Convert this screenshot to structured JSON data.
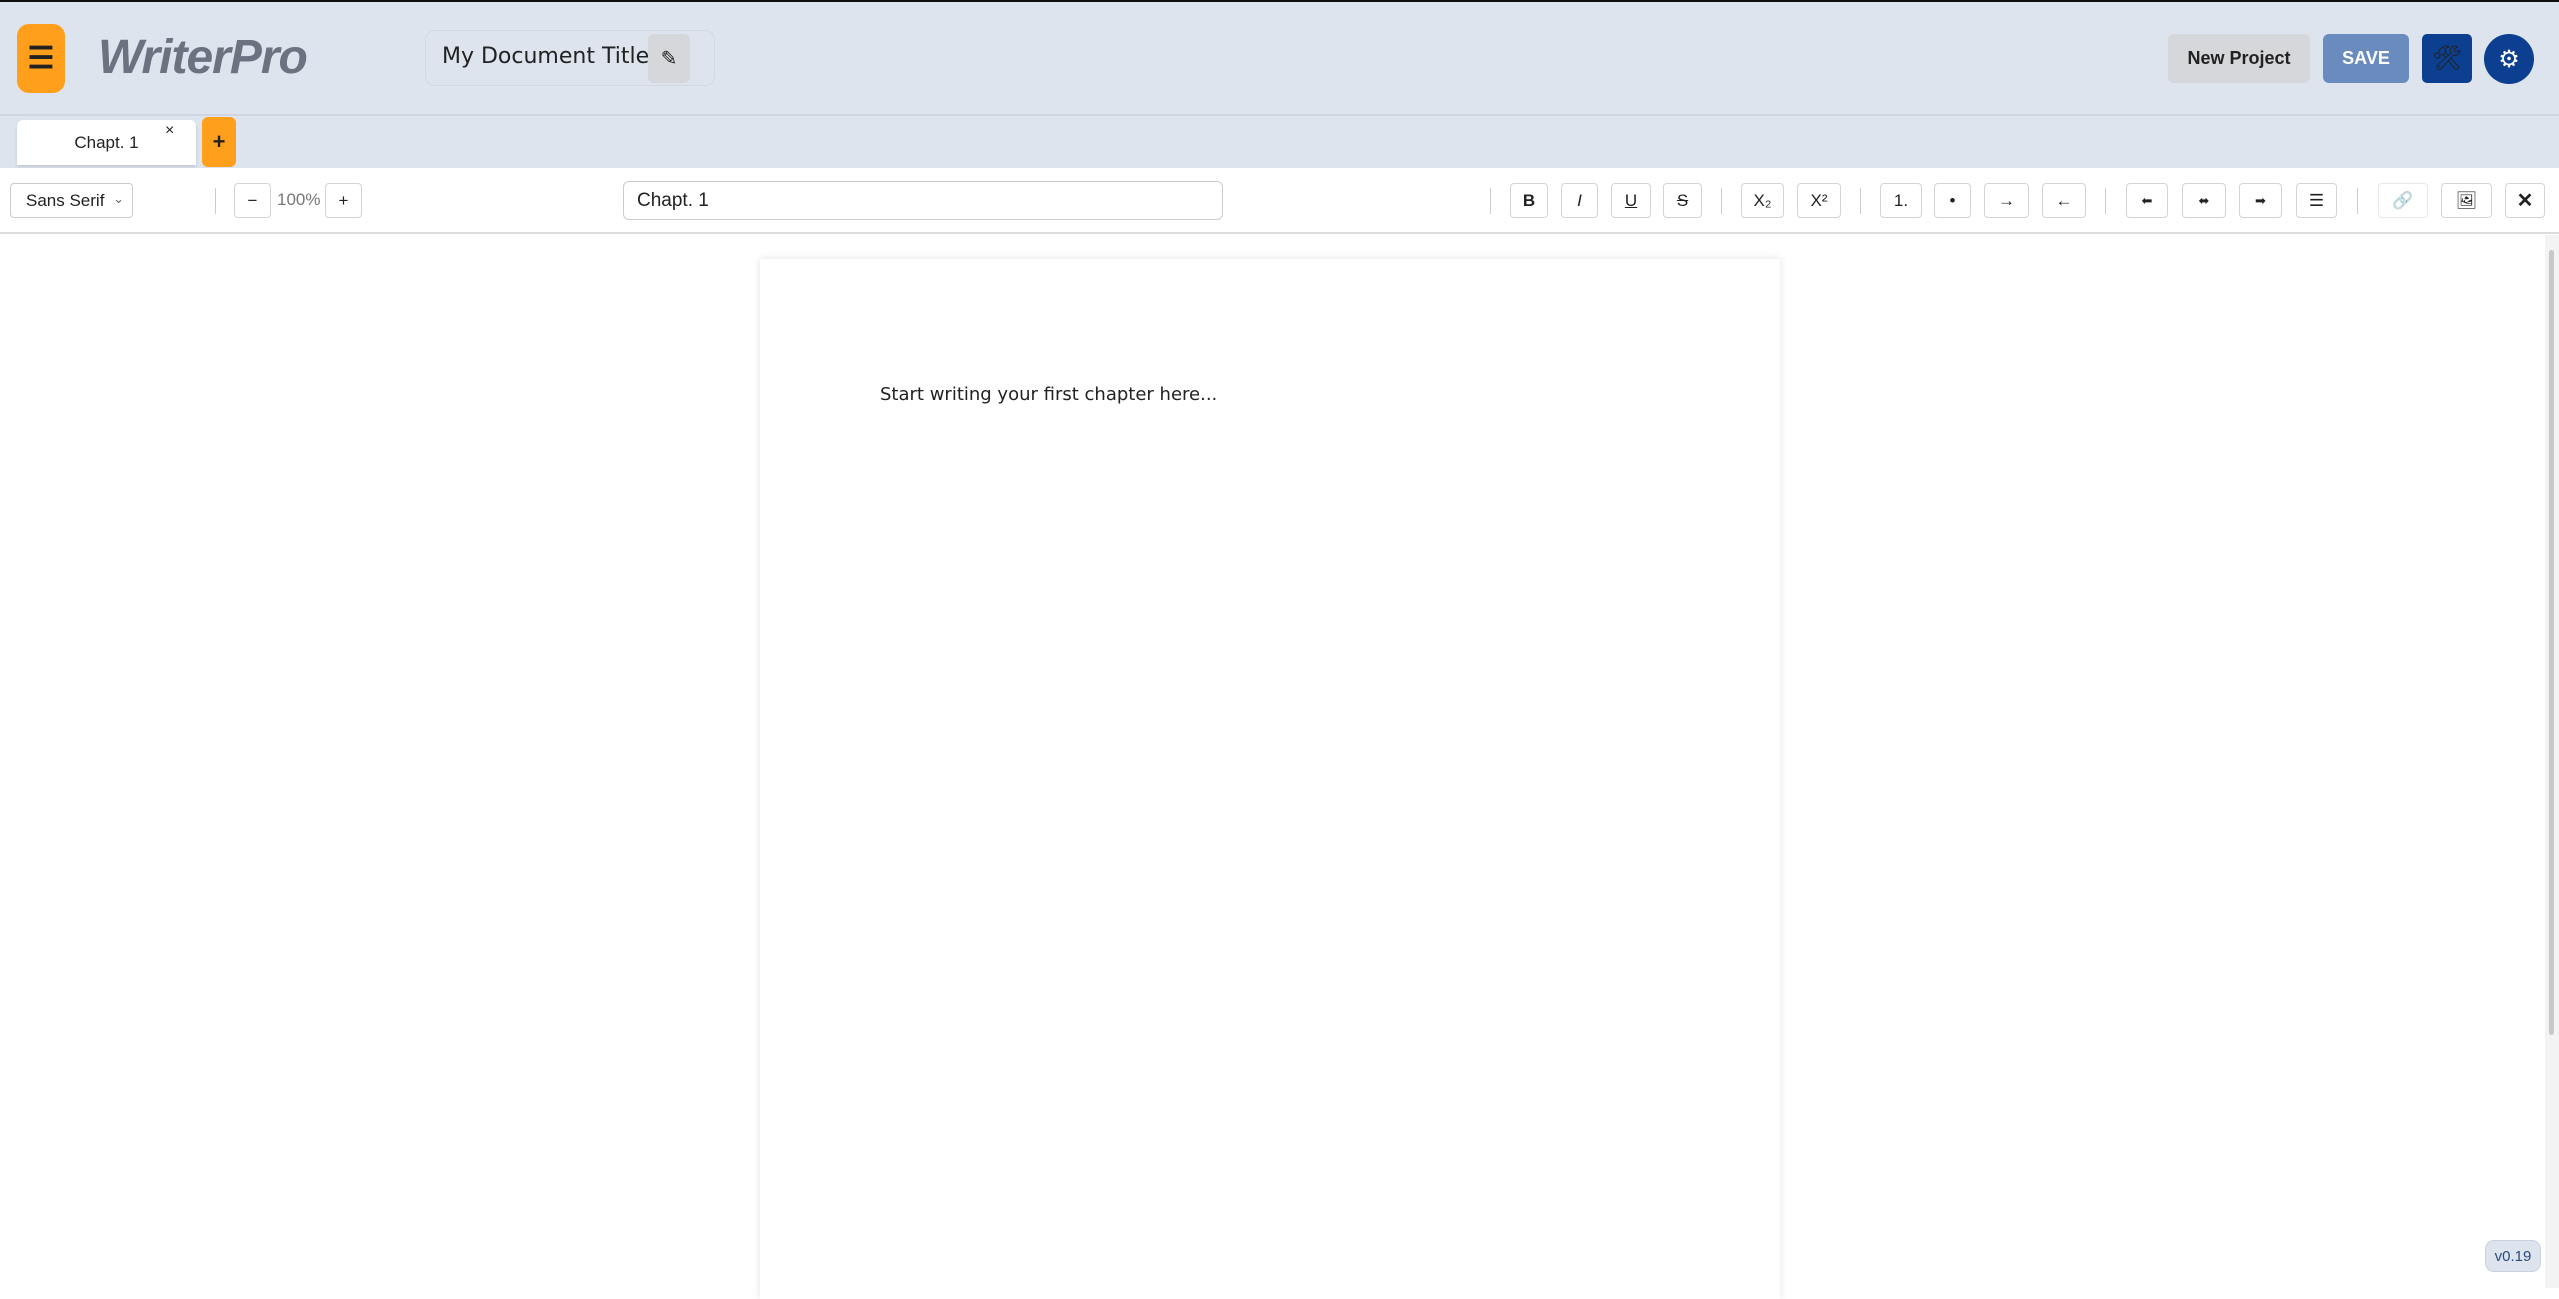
{
  "header": {
    "menu_icon": "hamburger-icon",
    "logo": "WriterPro",
    "document_title": "My Document Title",
    "edit_icon": "pencil-icon",
    "new_project_label": "New Project",
    "save_label": "SAVE",
    "tools_icon": "hammer-wrench-icon",
    "settings_icon": "gear-icon"
  },
  "tabs": {
    "items": [
      {
        "label": "Chapt. 1",
        "close": "×"
      }
    ],
    "add_label": "+"
  },
  "toolbar": {
    "font": "Sans Serif",
    "zoom_out": "−",
    "zoom": "100%",
    "zoom_in": "+",
    "chapter_name": "Chapt. 1",
    "buttons": {
      "bold": "B",
      "italic": "I",
      "underline": "U",
      "strike": "S",
      "subscript": "X₂",
      "superscript": "X²",
      "ordered": "1.",
      "bullet": "•",
      "indent": "→",
      "outdent": "←",
      "align_left": "⬅",
      "align_center": "⬌",
      "align_right": "➡",
      "justify": "☰",
      "link": "🔗",
      "image": "🖼",
      "clear": "✕"
    }
  },
  "editor": {
    "placeholder": "Start writing your first chapter here..."
  },
  "version": "v0.19",
  "colors": {
    "accent": "#ff9f1c",
    "primary": "#0c3f8f",
    "save": "#6a8bbe",
    "header_bg": "#dde4ee"
  }
}
